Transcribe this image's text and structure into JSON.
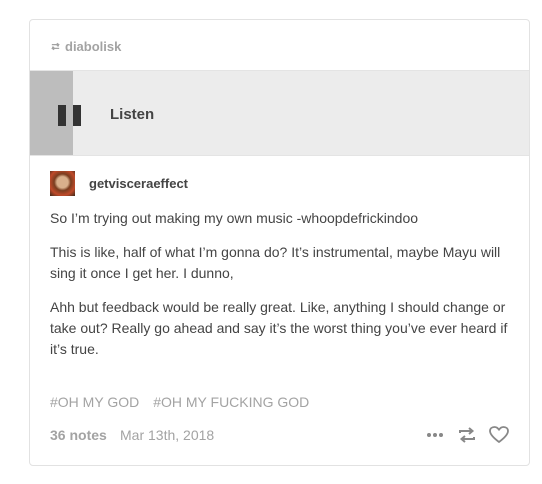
{
  "post": {
    "reblog": {
      "icon": "reblog-icon",
      "blog_name": "diabolisk"
    },
    "audio": {
      "icon": "pause-icon",
      "label": "Listen"
    },
    "author": {
      "avatar": "avatar",
      "username": "getvisceraeffect"
    },
    "body": [
      "So I’m trying out making my own music -whoopdefrickindoo",
      "This is like, half of what I’m gonna do? It’s instrumental, maybe Mayu will sing it once I get her. I dunno,",
      "Ahh but feedback would be really great. Like, anything I should change or take out? Really go ahead and say it’s the worst thing you’ve ever heard if it’s true."
    ],
    "tags": [
      "#OH MY GOD",
      "#OH MY FUCKING GOD"
    ],
    "footer": {
      "notes": "36 notes",
      "date": "Mar 13th, 2018",
      "actions": [
        "more-icon",
        "reblog-icon",
        "heart-icon"
      ]
    }
  },
  "colors": {
    "text": "#444444",
    "muted": "#a3a3a3",
    "audio_bg": "#ececec",
    "play_zone": "#bdbdbd",
    "border": "#e2e2e2"
  }
}
